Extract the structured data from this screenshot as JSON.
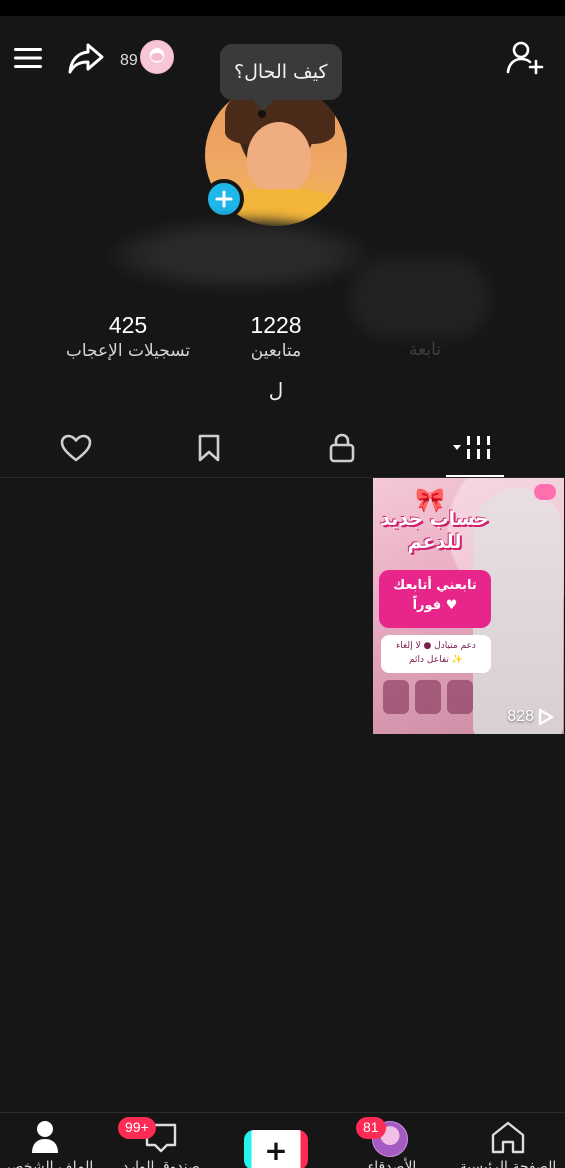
{
  "header": {
    "visitors_count": "89",
    "status_bubble": "كيف الحال؟"
  },
  "stats": {
    "likes": {
      "value": "425",
      "label": "تسجيلات الإعجاب"
    },
    "followers": {
      "value": "1228",
      "label": "متابعين"
    },
    "following": {
      "value": "",
      "label": "تابعة"
    }
  },
  "bio": "ل",
  "tabs": [
    {
      "name": "liked",
      "icon": "heart-icon"
    },
    {
      "name": "favorites",
      "icon": "bookmark-icon"
    },
    {
      "name": "private",
      "icon": "lock-icon"
    },
    {
      "name": "videos",
      "icon": "grid-icon"
    }
  ],
  "video": {
    "title_line1": "حساب جديد",
    "title_line2": "للدعم",
    "pink_line1": "تابعني أتابعك",
    "pink_line2": "فوراً ♥",
    "white_line1": "دعم متبادل ● لا إلغاء",
    "white_line2": "تفاعل دائم ✨",
    "views": "828"
  },
  "bottom_nav": {
    "profile_label": "الملف الشخصي",
    "inbox_label": "صندوق الوارد",
    "inbox_badge": "99+",
    "friends_label": "الأصدقاء",
    "friends_badge": "81",
    "home_label": "الصفحة الرئيسية"
  },
  "colors": {
    "background": "#161616",
    "accent_blue": "#1fb6e8",
    "badge_red": "#fe2c55",
    "create_cyan": "#25f4ee"
  }
}
